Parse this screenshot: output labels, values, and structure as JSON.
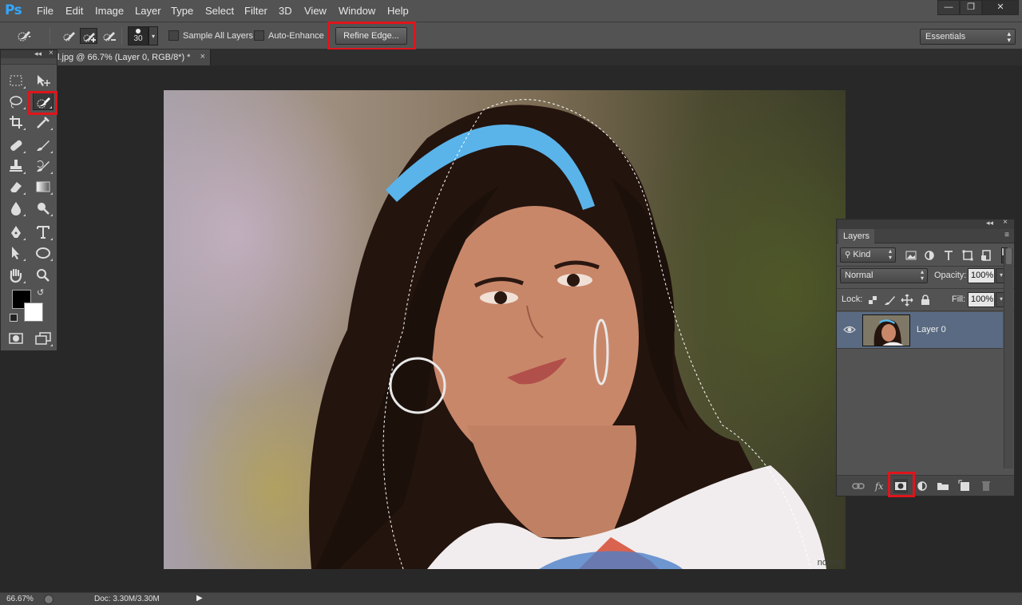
{
  "app": {
    "logo": "Ps",
    "menu": [
      "File",
      "Edit",
      "Image",
      "Layer",
      "Type",
      "Select",
      "Filter",
      "3D",
      "View",
      "Window",
      "Help"
    ],
    "window_controls": {
      "minimize": "—",
      "restore": "❐",
      "close": "✕"
    }
  },
  "options_bar": {
    "brush_size": "30",
    "sample_all_layers": "Sample All Layers",
    "auto_enhance": "Auto-Enhance",
    "refine_edge": "Refine Edge...",
    "workspace": "Essentials"
  },
  "document": {
    "tab_title": "l.jpg @ 66.7% (Layer 0, RGB/8*) *",
    "tab_close": "×",
    "watermark": "nd.org"
  },
  "toolbox": {
    "collapse": "◂◂",
    "close": "×"
  },
  "layers_panel": {
    "tab": "Layers",
    "collapse": "◂◂",
    "close": "×",
    "menu": "≡",
    "filter_kind": "Kind",
    "blend_mode": "Normal",
    "opacity_label": "Opacity:",
    "opacity_value": "100%",
    "lock_label": "Lock:",
    "fill_label": "Fill:",
    "fill_value": "100%",
    "layers": [
      {
        "name": "Layer 0",
        "visible": true,
        "selected": true
      }
    ]
  },
  "status_bar": {
    "zoom": "66.67%",
    "doc": "Doc: 3.30M/3.30M",
    "arrow": "▶"
  },
  "highlight_color": "#e0141b",
  "selected_layer_color": "#596a82"
}
